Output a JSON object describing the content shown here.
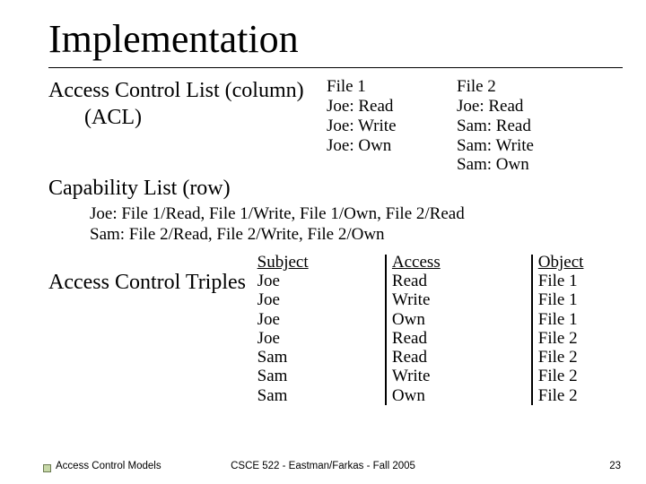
{
  "title": "Implementation",
  "acl": {
    "label_line1": "Access Control List (column)",
    "label_line2": "(ACL)",
    "files": [
      {
        "name": "File 1",
        "entries": [
          "Joe: Read",
          "Joe: Write",
          "Joe: Own"
        ]
      },
      {
        "name": "File 2",
        "entries": [
          "Joe: Read",
          "Sam: Read",
          "Sam: Write",
          "Sam: Own"
        ]
      }
    ]
  },
  "capability": {
    "label": "Capability List (row)",
    "lines": [
      "Joe: File 1/Read, File 1/Write, File 1/Own, File 2/Read",
      "Sam: File 2/Read, File 2/Write, File 2/Own"
    ]
  },
  "triples": {
    "label": "Access Control Triples",
    "headers": {
      "subject": "Subject",
      "access": "Access",
      "object": "Object"
    },
    "rows": [
      {
        "subject": "Joe",
        "access": "Read",
        "object": "File 1"
      },
      {
        "subject": "Joe",
        "access": "Write",
        "object": "File 1"
      },
      {
        "subject": "Joe",
        "access": "Own",
        "object": "File 1"
      },
      {
        "subject": "Joe",
        "access": "Read",
        "object": "File 2"
      },
      {
        "subject": "Sam",
        "access": "Read",
        "object": "File 2"
      },
      {
        "subject": "Sam",
        "access": "Write",
        "object": "File 2"
      },
      {
        "subject": "Sam",
        "access": "Own",
        "object": "File 2"
      }
    ]
  },
  "footer": {
    "left": "Access Control Models",
    "center": "CSCE 522 - Eastman/Farkas - Fall 2005",
    "right": "23"
  }
}
